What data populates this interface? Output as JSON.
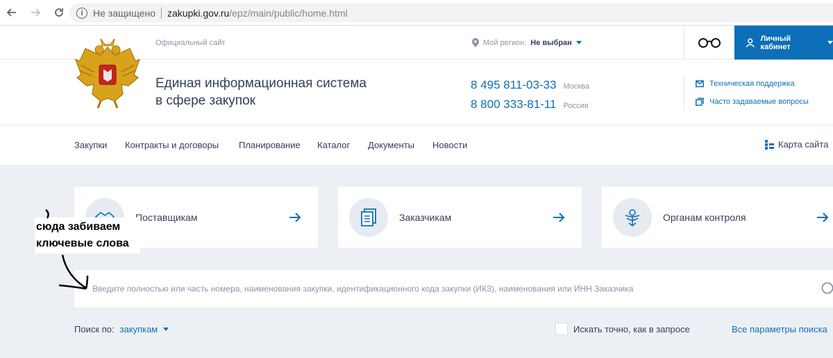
{
  "browser": {
    "security": "Не защищено",
    "host": "zakupki.gov.ru",
    "path": "/epz/main/public/home.html"
  },
  "topline": {
    "official": "Официальный сайт",
    "region_label": "Мой регион:",
    "region_value": "Не выбран",
    "cabinet": "Личный кабинет"
  },
  "header": {
    "title_line1": "Единая информационная система",
    "title_line2": "в сфере закупок",
    "phones": [
      {
        "number": "8 495 811-03-33",
        "city": "Москва"
      },
      {
        "number": "8 800 333-81-11",
        "city": "Россия"
      }
    ],
    "support": "Техническая поддержка",
    "faq": "Часто задаваемые вопросы"
  },
  "menu": {
    "items": [
      "Закупки",
      "Контракты и договоры",
      "Планирование",
      "Каталог",
      "Документы",
      "Новости"
    ],
    "sitemap": "Карта сайта"
  },
  "cards": [
    {
      "label": "Поставщикам",
      "icon": "handshake-icon"
    },
    {
      "label": "Заказчикам",
      "icon": "document-icon"
    },
    {
      "label": "Органам контроля",
      "icon": "emblem-icon"
    }
  ],
  "search": {
    "placeholder": "Введите полностью или часть номера, наименования закупки, идентификационного кода закупки (ИКЗ), наименования или ИНН Заказчика",
    "by_label": "Поиск по:",
    "by_value": "закупкам",
    "exact": "Искать точно, как в запросе",
    "all_params": "Все параметры поиска"
  },
  "annotation": {
    "line1": "сюда забиваем",
    "line2": "ключевые слова"
  },
  "colors": {
    "accent": "#0d6fb8",
    "text": "#334059",
    "grey_bg": "#ecf0f4"
  }
}
